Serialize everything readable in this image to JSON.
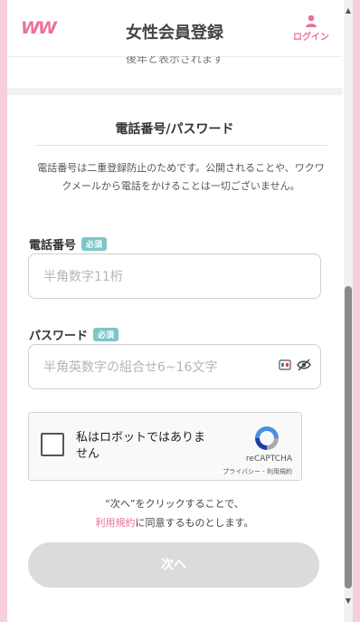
{
  "header": {
    "logo": "WW",
    "title": "女性会員登録",
    "login_label": "ログイン"
  },
  "partial_text": "後年と表示されます",
  "section": {
    "title": "電話番号/パスワード",
    "note": "電話番号は二重登録防止のためです。公開されることや、ワクワクメールから電話をかけることは一切ございません。"
  },
  "phone": {
    "label": "電話番号",
    "badge": "必須",
    "placeholder": "半角数字11桁"
  },
  "password": {
    "label": "パスワード",
    "badge": "必須",
    "placeholder": "半角英数字の組合せ6~16文字"
  },
  "captcha": {
    "label": "私はロボットではありません",
    "brand": "reCAPTCHA",
    "links": "プライバシー - 利用規約"
  },
  "agreement": {
    "line1": "“次へ”をクリックすることで、",
    "link": "利用規約",
    "line2_rest": "に同意するものとします。"
  },
  "next_button": "次へ",
  "colors": {
    "brand_pink": "#ec6f9b",
    "badge_teal": "#7cc6c6",
    "button_disabled": "#dadbdd"
  }
}
